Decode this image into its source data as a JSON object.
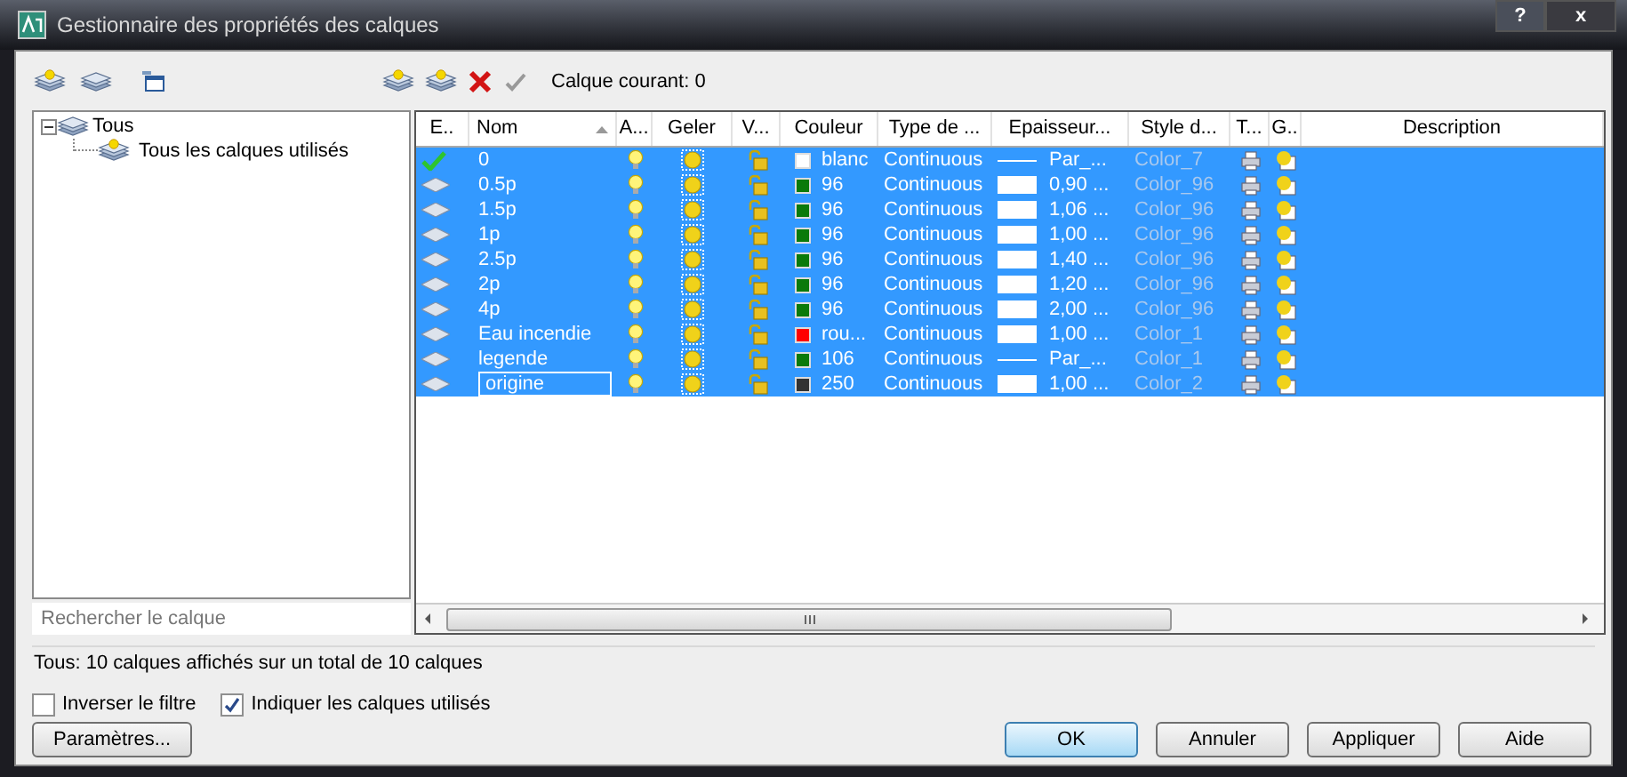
{
  "window": {
    "title": "Gestionnaire des propriétés des calques",
    "controls": [
      "?",
      "x"
    ]
  },
  "current_layer": {
    "label": "Calque courant: 0"
  },
  "tree": {
    "items": [
      {
        "label": "Tous",
        "expanded": true,
        "selected": false,
        "children": [
          {
            "label": "Tous les calques utilisés",
            "selected": false
          }
        ]
      }
    ]
  },
  "search": {
    "placeholder": "Rechercher le calque"
  },
  "table": {
    "columns": [
      {
        "label": "E..",
        "sorted": false
      },
      {
        "label": "Nom",
        "sorted": true
      },
      {
        "label": "A...",
        "sorted": false
      },
      {
        "label": "Geler",
        "sorted": false
      },
      {
        "label": "V...",
        "sorted": false
      },
      {
        "label": "Couleur",
        "sorted": false
      },
      {
        "label": "Type de ...",
        "sorted": false
      },
      {
        "label": "Epaisseur...",
        "sorted": false
      },
      {
        "label": "Style d...",
        "sorted": false
      },
      {
        "label": "T...",
        "sorted": false
      },
      {
        "label": "G..",
        "sorted": false
      },
      {
        "label": "Description",
        "sorted": false
      }
    ],
    "rows": [
      {
        "current": true,
        "name": "0",
        "editing": false,
        "selected": true,
        "color": "#ffffff",
        "color_label": "blanc",
        "linetype": "Continuous",
        "kind": "line",
        "lineweight": "Par_...",
        "plot_style": "Color_7"
      },
      {
        "current": false,
        "name": "0.5p",
        "editing": false,
        "selected": true,
        "color": "#0a7a0a",
        "color_label": "96",
        "linetype": "Continuous",
        "kind": "box",
        "lineweight": "0,90 ...",
        "plot_style": "Color_96"
      },
      {
        "current": false,
        "name": "1.5p",
        "editing": false,
        "selected": true,
        "color": "#0a7a0a",
        "color_label": "96",
        "linetype": "Continuous",
        "kind": "box",
        "lineweight": "1,06 ...",
        "plot_style": "Color_96"
      },
      {
        "current": false,
        "name": "1p",
        "editing": false,
        "selected": true,
        "color": "#0a7a0a",
        "color_label": "96",
        "linetype": "Continuous",
        "kind": "box",
        "lineweight": "1,00 ...",
        "plot_style": "Color_96"
      },
      {
        "current": false,
        "name": "2.5p",
        "editing": false,
        "selected": true,
        "color": "#0a7a0a",
        "color_label": "96",
        "linetype": "Continuous",
        "kind": "box",
        "lineweight": "1,40 ...",
        "plot_style": "Color_96"
      },
      {
        "current": false,
        "name": "2p",
        "editing": false,
        "selected": true,
        "color": "#0a7a0a",
        "color_label": "96",
        "linetype": "Continuous",
        "kind": "box",
        "lineweight": "1,20 ...",
        "plot_style": "Color_96"
      },
      {
        "current": false,
        "name": "4p",
        "editing": false,
        "selected": true,
        "color": "#0a7a0a",
        "color_label": "96",
        "linetype": "Continuous",
        "kind": "box",
        "lineweight": "2,00 ...",
        "plot_style": "Color_96"
      },
      {
        "current": false,
        "name": "Eau incendie",
        "editing": false,
        "selected": true,
        "color": "#ff0000",
        "color_label": "rou...",
        "linetype": "Continuous",
        "kind": "box",
        "lineweight": "1,00 ...",
        "plot_style": "Color_1"
      },
      {
        "current": false,
        "name": "legende",
        "editing": false,
        "selected": true,
        "color": "#0a7a0a",
        "color_label": "106",
        "linetype": "Continuous",
        "kind": "line",
        "lineweight": "Par_...",
        "plot_style": "Color_1"
      },
      {
        "current": false,
        "name": "origine",
        "editing": true,
        "selected": true,
        "color": "#333333",
        "color_label": "250",
        "linetype": "Continuous",
        "kind": "box",
        "lineweight": "1,00 ...",
        "plot_style": "Color_2"
      }
    ]
  },
  "status_bar": "Tous: 10 calques affichés sur un total de 10 calques",
  "options": [
    {
      "label": "Inverser le filtre",
      "checked": false
    },
    {
      "label": "Indiquer les calques utilisés",
      "checked": true
    }
  ],
  "settings_button": "Paramètres...",
  "buttons": [
    {
      "label": "OK",
      "default": true
    },
    {
      "label": "Annuler",
      "default": false
    },
    {
      "label": "Appliquer",
      "default": false
    },
    {
      "label": "Aide",
      "default": false
    }
  ]
}
